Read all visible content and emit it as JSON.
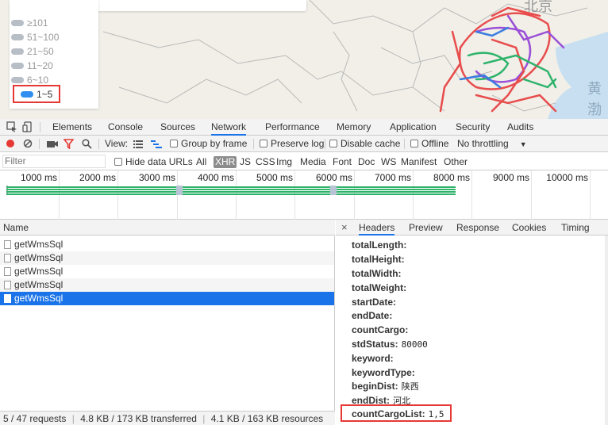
{
  "map": {
    "legend_items": [
      {
        "label": "≥101",
        "active": false
      },
      {
        "label": "51~100",
        "active": false
      },
      {
        "label": "21~50",
        "active": false
      },
      {
        "label": "11~20",
        "active": false
      },
      {
        "label": "6~10",
        "active": false
      },
      {
        "label": "1~5",
        "active": true
      }
    ],
    "city_label": "北京",
    "sea_label": "黄渤"
  },
  "devtools": {
    "tabs": [
      "Elements",
      "Console",
      "Sources",
      "Network",
      "Performance",
      "Memory",
      "Application",
      "Security",
      "Audits"
    ],
    "active_tab": "Network",
    "toolbar": {
      "view_label": "View:",
      "group_by_frame": "Group by frame",
      "preserve_log": "Preserve log",
      "disable_cache": "Disable cache",
      "offline": "Offline",
      "throttling": "No throttling"
    },
    "filter": {
      "placeholder": "Filter",
      "hide_data_urls": "Hide data URLs",
      "types": [
        "All",
        "XHR",
        "JS",
        "CSS",
        "Img",
        "Media",
        "Font",
        "Doc",
        "WS",
        "Manifest",
        "Other"
      ],
      "active_type": "XHR"
    },
    "timeline_ticks": [
      "1000 ms",
      "2000 ms",
      "3000 ms",
      "4000 ms",
      "5000 ms",
      "6000 ms",
      "7000 ms",
      "8000 ms",
      "9000 ms",
      "10000 ms"
    ],
    "requests": {
      "header": "Name",
      "items": [
        "getWmsSql",
        "getWmsSql",
        "getWmsSql",
        "getWmsSql",
        "getWmsSql"
      ],
      "selected_index": 4
    },
    "status": {
      "requests": "5 / 47 requests",
      "transferred": "4.8 KB / 173 KB transferred",
      "resources": "4.1 KB / 163 KB resources"
    },
    "detail": {
      "close": "×",
      "tabs": [
        "Headers",
        "Preview",
        "Response",
        "Cookies",
        "Timing"
      ],
      "active_tab": "Headers",
      "form_data": [
        {
          "key": "totalLength:",
          "value": ""
        },
        {
          "key": "totalHeight:",
          "value": ""
        },
        {
          "key": "totalWidth:",
          "value": ""
        },
        {
          "key": "totalWeight:",
          "value": ""
        },
        {
          "key": "startDate:",
          "value": ""
        },
        {
          "key": "endDate:",
          "value": ""
        },
        {
          "key": "countCargo:",
          "value": ""
        },
        {
          "key": "stdStatus:",
          "value": "80000"
        },
        {
          "key": "keyword:",
          "value": ""
        },
        {
          "key": "keywordType:",
          "value": ""
        },
        {
          "key": "beginDist:",
          "value": "陕西"
        },
        {
          "key": "endDist:",
          "value": "河北"
        },
        {
          "key": "countCargoList:",
          "value": "1,5"
        }
      ]
    }
  }
}
